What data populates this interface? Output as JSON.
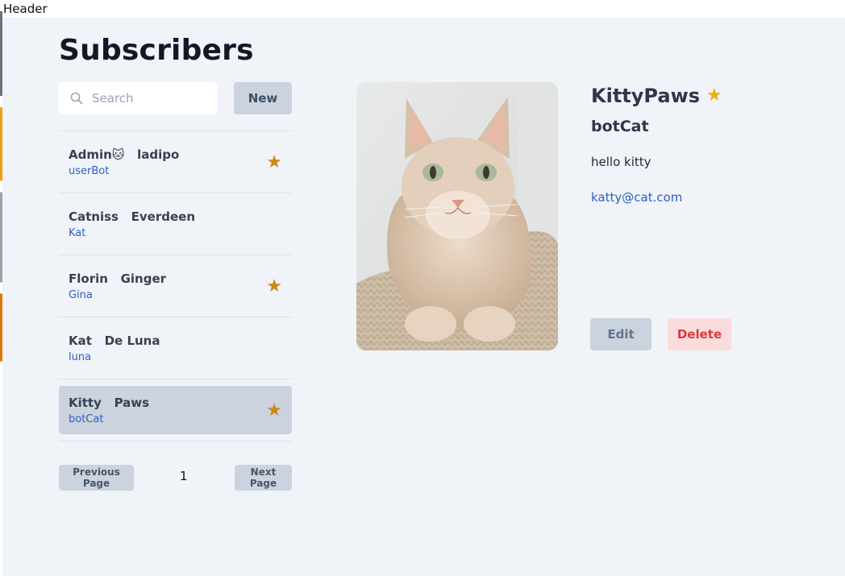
{
  "header": {
    "label": "Header"
  },
  "page": {
    "title": "Subscribers"
  },
  "search": {
    "placeholder": "Search",
    "value": ""
  },
  "toolbar": {
    "new_label": "New"
  },
  "subscribers": [
    {
      "first": "Admin🐱",
      "last": "ladipo",
      "handle": "userBot",
      "favorite": true,
      "selected": false
    },
    {
      "first": "Catniss",
      "last": "Everdeen",
      "handle": "Kat",
      "favorite": false,
      "selected": false
    },
    {
      "first": "Florin",
      "last": "Ginger",
      "handle": "Gina",
      "favorite": true,
      "selected": false
    },
    {
      "first": "Kat",
      "last": "De Luna",
      "handle": "luna",
      "favorite": false,
      "selected": false
    },
    {
      "first": "Kitty",
      "last": "Paws",
      "handle": "botCat",
      "favorite": true,
      "selected": true
    }
  ],
  "pagination": {
    "prev_label": "Previous Page",
    "page": "1",
    "next_label": "Next Page"
  },
  "detail": {
    "first": "Kitty",
    "last": "Paws",
    "favorite": true,
    "handle": "botCat",
    "bio": "hello kitty",
    "email": "katty@cat.com",
    "edit_label": "Edit",
    "delete_label": "Delete"
  },
  "icons": {
    "search": "search-icon",
    "favorite": "star-icon",
    "photo": "cat-photo"
  },
  "colors": {
    "background": "#f0f3f8",
    "button": "#cbd3de",
    "link": "#2d5fc4",
    "star": "#cc8a12",
    "detail_star": "#eab308",
    "delete_bg": "#fbdcdc",
    "delete_text": "#dc3a3a"
  }
}
